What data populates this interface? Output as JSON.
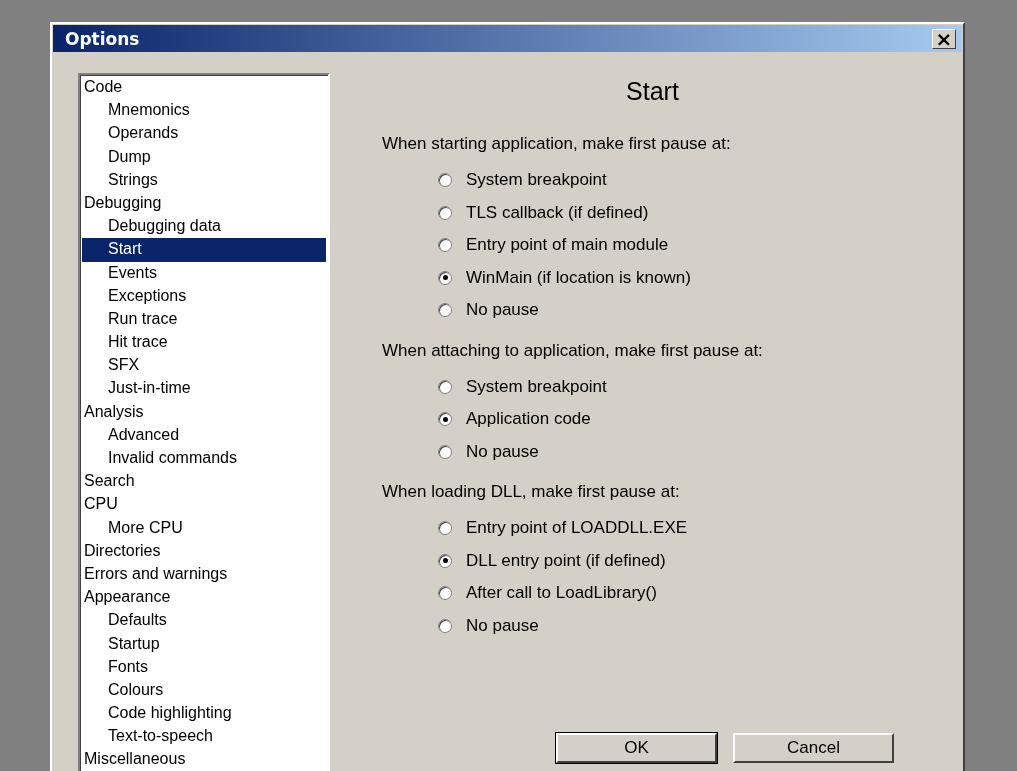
{
  "window": {
    "title": "Options",
    "close_glyph": "×"
  },
  "tree": [
    {
      "label": "Code",
      "selected": false,
      "children": [
        {
          "label": "Mnemonics",
          "selected": false
        },
        {
          "label": "Operands",
          "selected": false
        },
        {
          "label": "Dump",
          "selected": false
        },
        {
          "label": "Strings",
          "selected": false
        }
      ]
    },
    {
      "label": "Debugging",
      "selected": false,
      "children": [
        {
          "label": "Debugging data",
          "selected": false
        },
        {
          "label": "Start",
          "selected": true
        },
        {
          "label": "Events",
          "selected": false
        },
        {
          "label": "Exceptions",
          "selected": false
        },
        {
          "label": "Run trace",
          "selected": false
        },
        {
          "label": "Hit trace",
          "selected": false
        },
        {
          "label": "SFX",
          "selected": false
        },
        {
          "label": "Just-in-time",
          "selected": false
        }
      ]
    },
    {
      "label": "Analysis",
      "selected": false,
      "children": [
        {
          "label": "Advanced",
          "selected": false
        },
        {
          "label": "Invalid commands",
          "selected": false
        }
      ]
    },
    {
      "label": "Search",
      "selected": false
    },
    {
      "label": "CPU",
      "selected": false,
      "children": [
        {
          "label": "More CPU",
          "selected": false
        }
      ]
    },
    {
      "label": "Directories",
      "selected": false
    },
    {
      "label": "Errors and warnings",
      "selected": false
    },
    {
      "label": "Appearance",
      "selected": false,
      "children": [
        {
          "label": "Defaults",
          "selected": false
        },
        {
          "label": "Startup",
          "selected": false
        },
        {
          "label": "Fonts",
          "selected": false
        },
        {
          "label": "Colours",
          "selected": false
        },
        {
          "label": "Code highlighting",
          "selected": false
        },
        {
          "label": "Text-to-speech",
          "selected": false
        }
      ]
    },
    {
      "label": "Miscellaneous",
      "selected": false
    }
  ],
  "panel": {
    "heading": "Start",
    "groups": [
      {
        "label": "When starting application, make first pause at:",
        "options": [
          {
            "label": "System breakpoint",
            "selected": false
          },
          {
            "label": "TLS callback (if defined)",
            "selected": false
          },
          {
            "label": "Entry point of main module",
            "selected": false
          },
          {
            "label": "WinMain (if location is known)",
            "selected": true
          },
          {
            "label": "No pause",
            "selected": false
          }
        ]
      },
      {
        "label": "When attaching to application, make first pause at:",
        "options": [
          {
            "label": "System breakpoint",
            "selected": false
          },
          {
            "label": "Application code",
            "selected": true
          },
          {
            "label": "No pause",
            "selected": false
          }
        ]
      },
      {
        "label": "When loading DLL, make first pause at:",
        "options": [
          {
            "label": "Entry point of LOADDLL.EXE",
            "selected": false
          },
          {
            "label": "DLL entry point (if defined)",
            "selected": true
          },
          {
            "label": "After call to LoadLibrary()",
            "selected": false
          },
          {
            "label": "No pause",
            "selected": false
          }
        ]
      }
    ]
  },
  "buttons": [
    {
      "label": "OK",
      "default": true
    },
    {
      "label": "Cancel",
      "default": false
    }
  ]
}
